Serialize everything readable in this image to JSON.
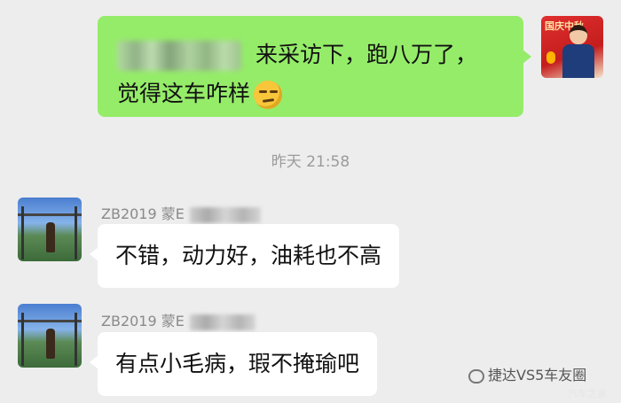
{
  "outgoing": {
    "line1": "来采访下，跑八万了，",
    "line2": "觉得这车咋样",
    "emoji": "smirk-emoji",
    "avatar_text": "国庆中秋"
  },
  "timestamp": "昨天 21:58",
  "incoming": [
    {
      "sender": "ZB2019 蒙E",
      "text": "不错，动力好，油耗也不高"
    },
    {
      "sender": "ZB2019 蒙E",
      "text": "有点小毛病，瑕不掩瑜吧"
    }
  ],
  "watermark": {
    "text": "捷达VS5车友圈",
    "sub": "汽车之家"
  },
  "colors": {
    "background": "#ededed",
    "outgoing_bubble": "#95ec69",
    "incoming_bubble": "#ffffff",
    "timestamp": "#9b9b9b"
  }
}
